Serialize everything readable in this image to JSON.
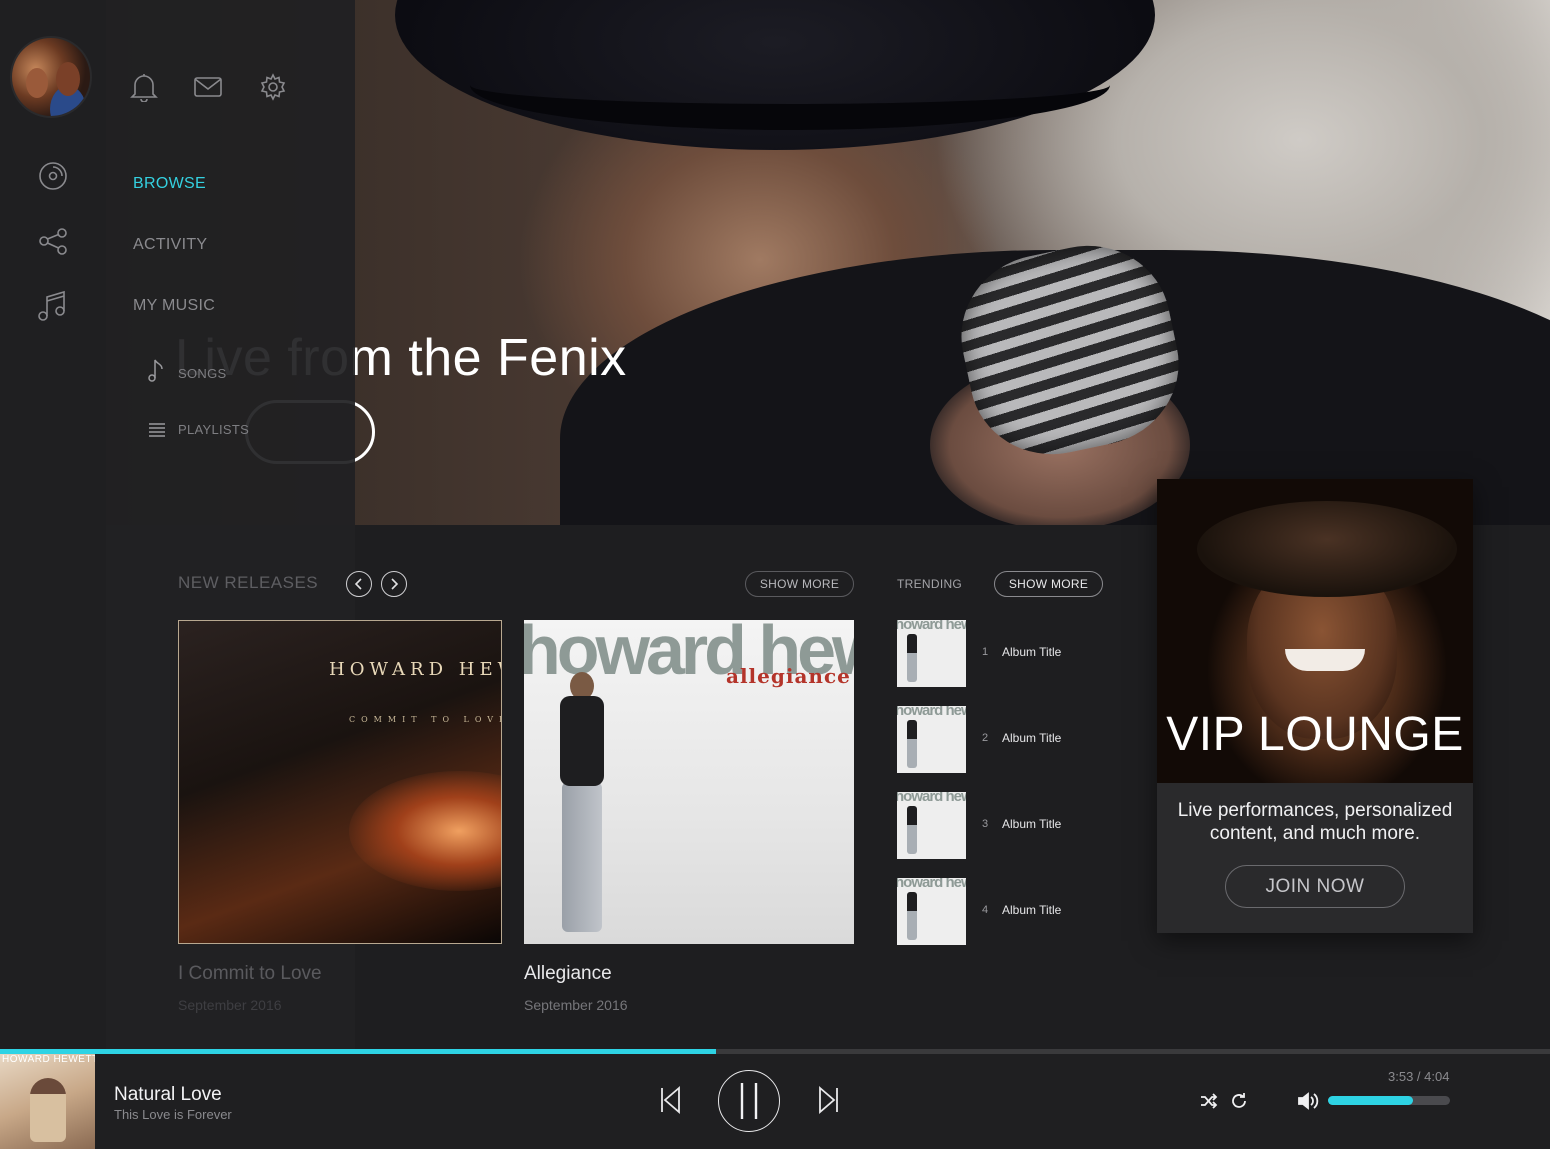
{
  "hero": {
    "title": "Live from the Fenix"
  },
  "sidebar": {
    "items": [
      {
        "label": "BROWSE",
        "active": true
      },
      {
        "label": "ACTIVITY",
        "active": false
      },
      {
        "label": "MY MUSIC",
        "active": false
      }
    ],
    "sub_items": [
      {
        "label": "SONGS",
        "icon": "music-note-icon"
      },
      {
        "label": "PLAYLISTS",
        "icon": "list-icon"
      }
    ],
    "header_icons": [
      "bell-icon",
      "mail-icon",
      "gear-icon"
    ],
    "rail_icons": [
      "disc-icon",
      "share-icon",
      "music-icon"
    ]
  },
  "new_releases": {
    "label": "NEW RELEASES",
    "show_more": "SHOW MORE",
    "albums": [
      {
        "title": "I Commit to Love",
        "date": "September 2016",
        "cover_artist": "HOWARD HEWETT",
        "cover_text": "COMMIT TO LOVE"
      },
      {
        "title": "Allegiance",
        "date": "September 2016",
        "cover_artist": "howard hewett",
        "cover_text": "allegiance"
      }
    ]
  },
  "trending": {
    "label": "TRENDING",
    "show_more": "SHOW MORE",
    "items": [
      {
        "rank": "1",
        "title": "Album Title"
      },
      {
        "rank": "2",
        "title": "Album Title"
      },
      {
        "rank": "3",
        "title": "Album Title"
      },
      {
        "rank": "4",
        "title": "Album Title"
      }
    ],
    "thumb_text": "howard hewett"
  },
  "vip": {
    "title": "VIP LOUNGE",
    "text": "Live performances, personalized content, and much more.",
    "button": "JOIN NOW"
  },
  "player": {
    "track_title": "Natural Love",
    "track_subtitle": "This Love is Forever",
    "art_text": "HOWARD HEWETT",
    "time": "3:53 / 4:04",
    "progress_fraction": 0.462,
    "volume_fraction": 0.7
  },
  "colors": {
    "accent": "#2ed3e4",
    "background": "#1e1e20"
  }
}
